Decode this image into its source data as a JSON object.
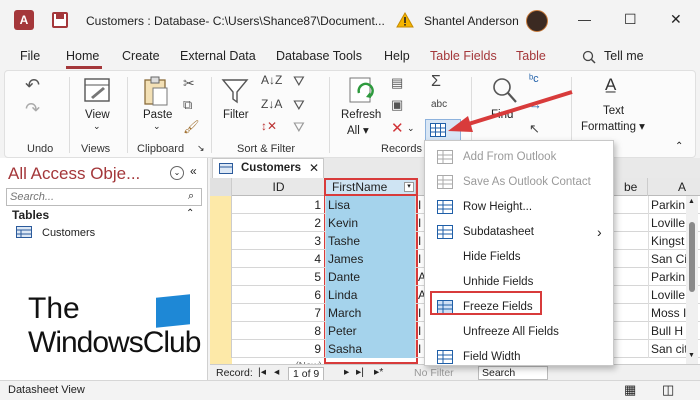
{
  "titlebar": {
    "app_letter": "A",
    "title": "Customers : Database- C:\\Users\\Shance87\\Document...",
    "user": "Shantel Anderson",
    "minimize": "—",
    "maximize": "☐",
    "close": "✕"
  },
  "menu": [
    "File",
    "Home",
    "Create",
    "External Data",
    "Database Tools",
    "Help",
    "Table Fields",
    "Table"
  ],
  "tell_me": "Tell me",
  "ribbon": {
    "undo": "Undo",
    "view": "View",
    "views": "Views",
    "paste": "Paste",
    "clipboard": "Clipboard",
    "filter": "Filter",
    "sort_filter": "Sort & Filter",
    "refresh": "Refresh",
    "all": "All ▾",
    "records": "Records",
    "find": "Find",
    "text": "Text",
    "formatting": "Formatting ▾",
    "sigma": "Σ",
    "abc": "abc"
  },
  "nav": {
    "title": "All Access Obje...",
    "search_placeholder": "Search...",
    "section": "Tables",
    "item": "Customers"
  },
  "tab": {
    "label": "Customers",
    "close": "✕"
  },
  "grid": {
    "headers": [
      "ID",
      "FirstName",
      "be",
      "A"
    ],
    "rows": [
      {
        "id": "1",
        "first": "Lisa",
        "mid": "I",
        "addr": "Parkin"
      },
      {
        "id": "2",
        "first": "Kevin",
        "mid": "I",
        "addr": "Loville"
      },
      {
        "id": "3",
        "first": "Tashe",
        "mid": "I",
        "addr": "Kingst"
      },
      {
        "id": "4",
        "first": "James",
        "mid": "I",
        "addr": "San Ci"
      },
      {
        "id": "5",
        "first": "Dante",
        "mid": "A",
        "addr": "Parkin"
      },
      {
        "id": "6",
        "first": "Linda",
        "mid": "A",
        "addr": "Loville"
      },
      {
        "id": "7",
        "first": "March",
        "mid": "I",
        "addr": "Moss I"
      },
      {
        "id": "8",
        "first": "Peter",
        "mid": "I",
        "addr": "Bull H"
      },
      {
        "id": "9",
        "first": "Sasha",
        "mid": "I",
        "addr": "San cit"
      }
    ],
    "new_row": "(New)"
  },
  "record_nav": {
    "label": "Record:",
    "first": "|◂",
    "prev": "◂",
    "position": "1 of 9",
    "next": "▸",
    "last": "▸|",
    "new": "▸*",
    "filter": "No Filter",
    "search": "Search"
  },
  "dropdown": [
    {
      "label": "Add From Outlook",
      "disabled": true
    },
    {
      "label": "Save As Outlook Contact",
      "disabled": true
    },
    {
      "label": "Row Height...",
      "disabled": false
    },
    {
      "label": "Subdatasheet",
      "disabled": false,
      "submenu": "›"
    },
    {
      "label": "Hide Fields",
      "disabled": false
    },
    {
      "label": "Unhide Fields",
      "disabled": false
    },
    {
      "label": "Freeze Fields",
      "disabled": false
    },
    {
      "label": "Unfreeze All Fields",
      "disabled": false
    },
    {
      "label": "Field Width",
      "disabled": false
    }
  ],
  "status": {
    "text": "Datasheet View"
  },
  "watermark": {
    "line1": "The",
    "line2": "WindowsClub"
  },
  "colors": {
    "accent": "#a4373a",
    "selection": "#a5d3ec",
    "highlight": "#d83b3b"
  }
}
